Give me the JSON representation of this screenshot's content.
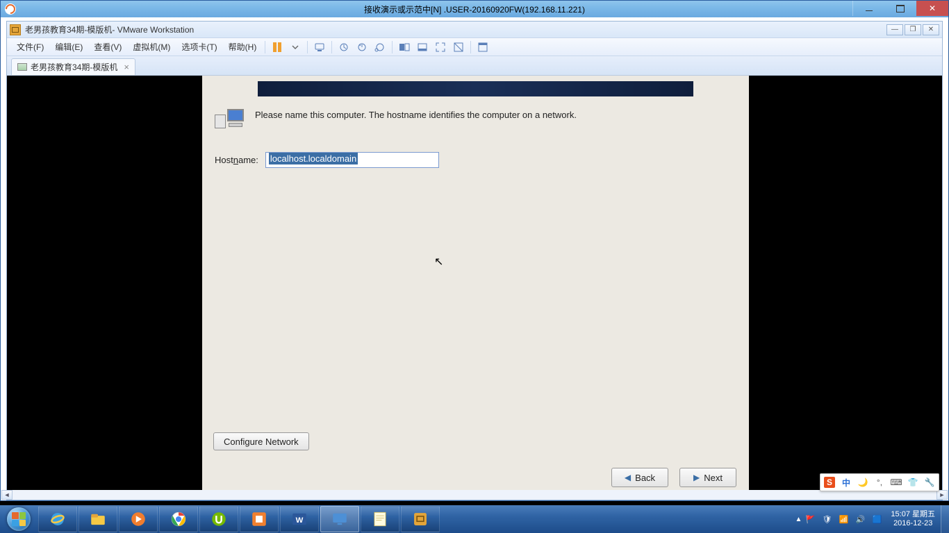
{
  "outer": {
    "title": "接收演示或示范中[N] .USER-20160920FW(192.168.11.221)"
  },
  "vmware": {
    "title_doc": "老男孩教育34期-模版机",
    "title_app": " - VMware Workstation",
    "menu": {
      "file": "文件(F)",
      "edit": "编辑(E)",
      "view": "查看(V)",
      "vm": "虚拟机(M)",
      "tabs": "选项卡(T)",
      "help": "帮助(H)"
    },
    "tab": {
      "label": "老男孩教育34期-模版机"
    }
  },
  "installer": {
    "prompt": "Please name this computer.  The hostname identifies the computer on a network.",
    "hostname_label_pre": "Host",
    "hostname_label_u": "n",
    "hostname_label_post": "ame:",
    "hostname_value": "localhost.localdomain",
    "configure_network": "Configure Network",
    "back": "Back",
    "next": "Next"
  },
  "ime": {
    "logo": "S",
    "lang": "中"
  },
  "tray": {
    "time": "15:07",
    "weekday": "星期五",
    "date": "2016-12-23"
  }
}
